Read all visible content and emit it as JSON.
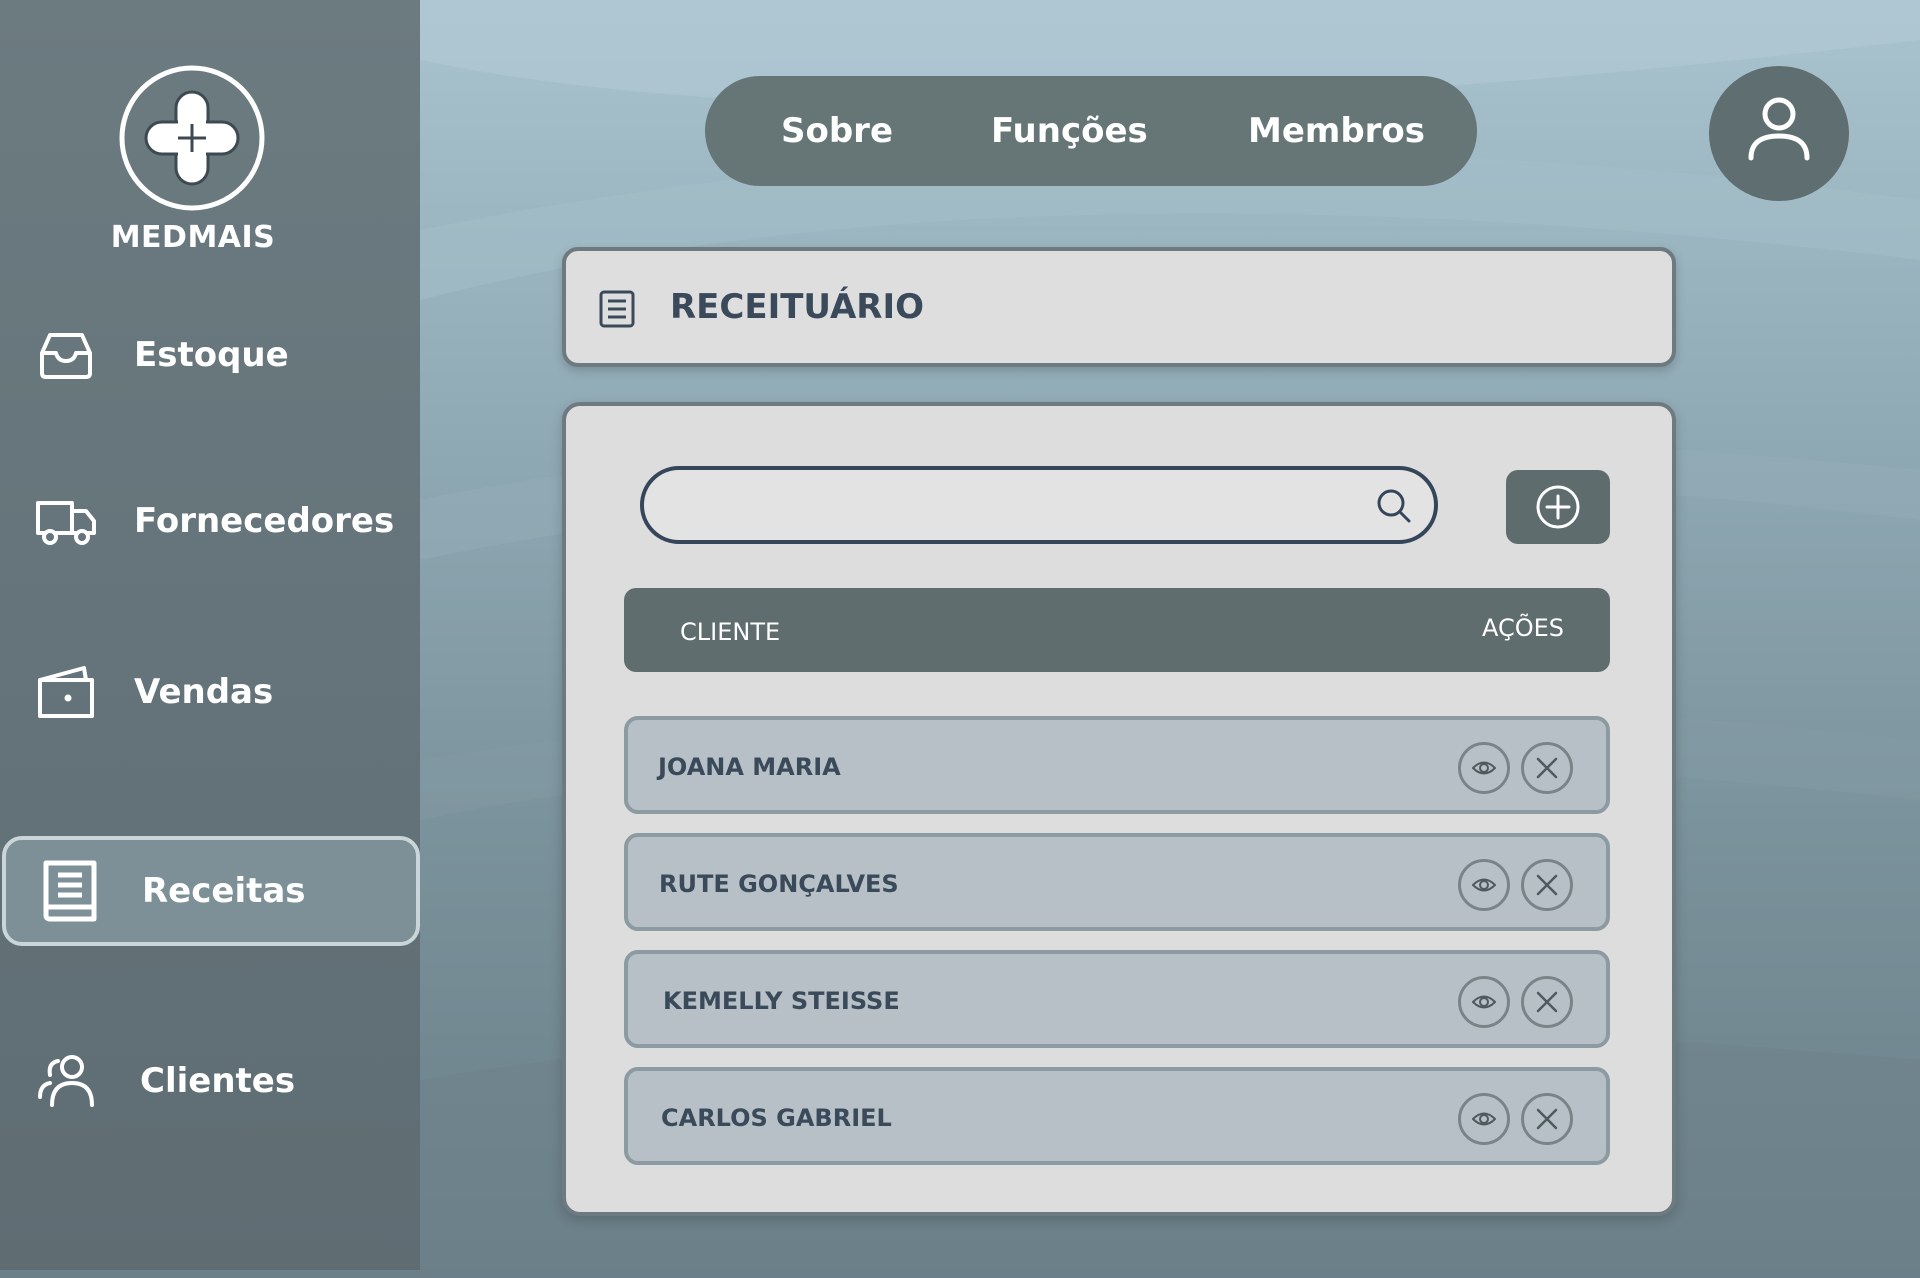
{
  "brand": {
    "name": "MEDMAIS",
    "logo_icon": "medical-cross-icon"
  },
  "sidebar": {
    "items": [
      {
        "label": "Estoque",
        "icon": "inbox-tray-icon",
        "active": false
      },
      {
        "label": "Fornecedores",
        "icon": "truck-icon",
        "active": false
      },
      {
        "label": "Vendas",
        "icon": "wallet-icon",
        "active": false
      },
      {
        "label": "Receitas",
        "icon": "notebook-icon",
        "active": true
      },
      {
        "label": "Clientes",
        "icon": "users-icon",
        "active": false
      }
    ]
  },
  "top_menu": {
    "items": [
      {
        "label": "Sobre"
      },
      {
        "label": "Funções"
      },
      {
        "label": "Membros"
      }
    ],
    "profile_icon": "user-icon"
  },
  "page": {
    "title": "RECEITUÁRIO",
    "title_icon": "document-list-icon"
  },
  "search": {
    "value": "",
    "placeholder": "",
    "icon": "search-icon"
  },
  "add_button": {
    "icon": "plus-circle-icon"
  },
  "table": {
    "columns": {
      "client": "CLIENTE",
      "actions": "AÇÕES"
    },
    "rows": [
      {
        "client": "JOANA MARIA"
      },
      {
        "client": "RUTE GONÇALVES"
      },
      {
        "client": "KEMELLY STEISSE"
      },
      {
        "client": "CARLOS GABRIEL"
      }
    ],
    "row_actions": [
      "eye-icon",
      "close-icon"
    ]
  },
  "colors": {
    "sidebar": "#64747a",
    "panel": "#dddddd",
    "header_bar": "#606d6f",
    "row": "#b6c0c6",
    "title_text": "#3b4a5a"
  }
}
